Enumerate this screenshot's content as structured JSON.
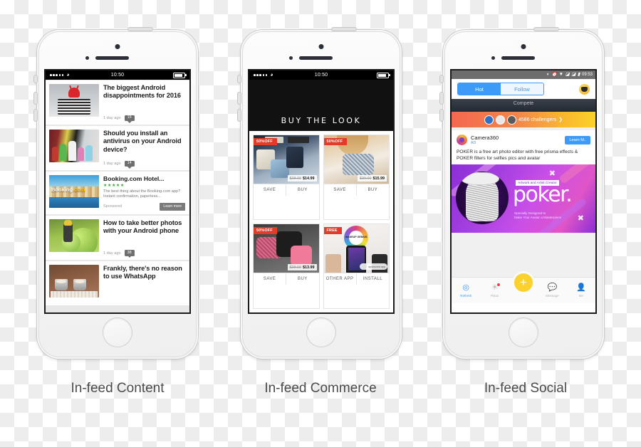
{
  "captions": {
    "content": "In-feed Content",
    "commerce": "In-feed Commerce",
    "social": "In-feed Social"
  },
  "phone_content": {
    "status": {
      "time": "10:50",
      "wifi_icon": "wifi-icon",
      "signal_dots": 5
    },
    "articles": [
      {
        "title": "The biggest Android disappointments for 2016",
        "age": "1 day ago",
        "comments": "15",
        "thumb": "android-bugdroid-on-phones"
      },
      {
        "title": "Should you install an antivirus on your Android device?",
        "age": "1 day ago",
        "comments": "14",
        "thumb": "vinyl-toy-figures"
      },
      {
        "title": "How to take better photos with your Android phone",
        "age": "1 day ago",
        "comments": "38",
        "thumb": "lego-figure-green-balls"
      },
      {
        "title": "Frankly, there's no reason to use WhatsApp",
        "age": "",
        "comments": "",
        "thumb": "coffee-cups-newspaper"
      }
    ],
    "ad": {
      "title": "Booking.com Hotel...",
      "stars": "★★★★★",
      "description": "The best thing about the Booking.com app? Instant confirmation, paperless...",
      "sponsored_label": "Sponsored",
      "cta": "Learn more",
      "logo_text": "Booking",
      "logo_text_accent": ".com"
    }
  },
  "phone_commerce": {
    "status": {
      "time": "10:50",
      "wifi_icon": "wifi-icon",
      "signal_dots": 5
    },
    "header": "BUY THE LOOK",
    "cards": [
      {
        "tag": "50%OFF",
        "old_price": "$28.00",
        "price": "$14.99",
        "actions": [
          "SAVE",
          "BUY"
        ],
        "image": "denim-shorts-flatlay"
      },
      {
        "tag": "50%OFF",
        "old_price": "$30.00",
        "price": "$15.99",
        "actions": [
          "SAVE",
          "BUY"
        ],
        "image": "crochet-crop-top"
      },
      {
        "tag": "50%OFF",
        "old_price": "$28.00",
        "price": "$13.99",
        "actions": [
          "SAVE",
          "BUY"
        ],
        "image": "lace-lingerie-set"
      },
      {
        "tag": "FREE",
        "old_price": "",
        "price": "",
        "actions": [
          "OTHER APP",
          "INSTALL"
        ],
        "image": "makeup-genius-app",
        "badge_text": "MAKEUP GENIUS",
        "sponsored_label": "sponsored app"
      }
    ]
  },
  "phone_social": {
    "status": {
      "time": "09:53",
      "icons": [
        "do-not-disturb-icon",
        "alarm-icon",
        "wifi-icon",
        "signal-icon",
        "signal-icon",
        "battery-icon"
      ]
    },
    "tabs": {
      "hot": "Hot",
      "follow": "Follow",
      "selected": "Hot"
    },
    "banner": {
      "label": "Compete",
      "challengers": "4586 challengers",
      "chevron": "chevron-right-icon"
    },
    "ad": {
      "app_name": "Camera360",
      "ad_label": "AD",
      "cta": "Learn M..",
      "copy": "POKER is a free art photo editor with free prisma effects & POKER filters for selfies pics and avatar"
    },
    "creative": {
      "badge": "Artwork and Artist Creator",
      "wordmark": "poker.",
      "tagline_line1": "Specially Designed to",
      "tagline_line2": "Make Your Avatar a Masterpiece"
    },
    "tabbar": [
      {
        "label": "Refresh",
        "icon": "refresh-icon",
        "active": true,
        "dot": false
      },
      {
        "label": "Plaza",
        "icon": "globe-icon",
        "active": false,
        "dot": true
      },
      {
        "label": "Message",
        "icon": "message-icon",
        "active": false,
        "dot": false
      },
      {
        "label": "Me",
        "icon": "person-icon",
        "active": false,
        "dot": false
      }
    ],
    "compose_button": "+"
  },
  "colors": {
    "accent_blue": "#3d9bf7",
    "accent_yellow": "#fbd12e",
    "sale_red": "#e23b28",
    "star_green": "#3fa83f"
  }
}
